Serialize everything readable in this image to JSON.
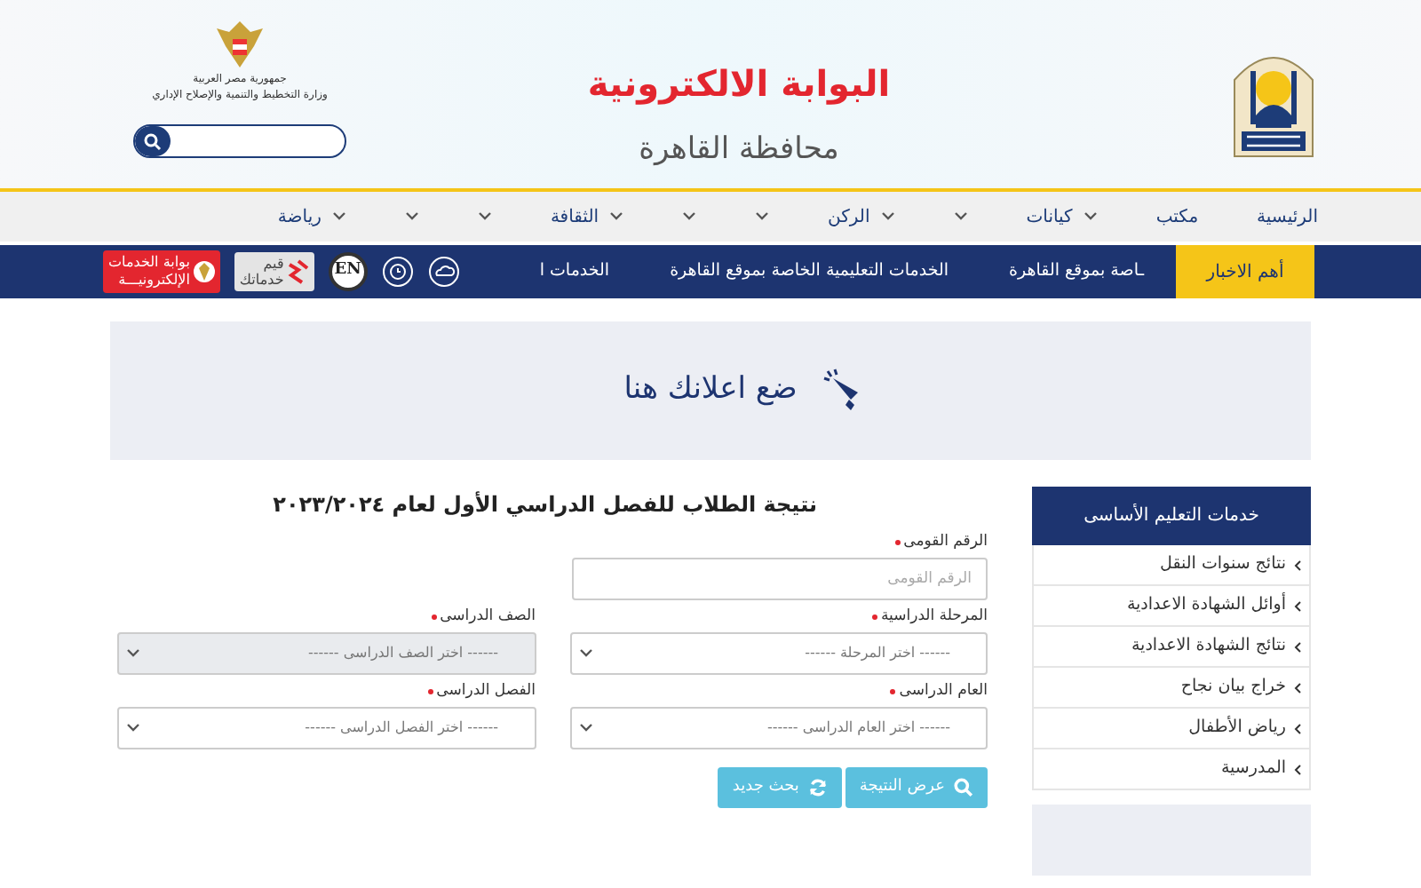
{
  "header": {
    "site_title": "البوابة الالكترونية",
    "governorate": "محافظة القاهرة",
    "ministry_lines": [
      "جمهورية مصر العربية",
      "وزارة التخطيط والتنمية والإصلاح الإداري"
    ]
  },
  "nav": [
    {
      "label": "الرئيسية",
      "has_menu": false
    },
    {
      "label": "مكتب",
      "has_menu": false
    },
    {
      "label": "كيانات",
      "has_menu": true
    },
    {
      "has_menu": true
    },
    {
      "label": "الركن",
      "has_menu": true
    },
    {
      "has_menu": true
    },
    {
      "has_menu": true
    },
    {
      "label": "الثقافة",
      "has_menu": true
    },
    {
      "has_menu": true
    },
    {
      "has_menu": true
    },
    {
      "label": "رياضة",
      "has_menu": true
    }
  ],
  "news_bar": {
    "label": "أهم الاخبار",
    "ticker": [
      "ـاصة بموقع القاهرة",
      "الخدمات التعليمية الخاصة بموقع القاهرة",
      "الخدمات ا"
    ],
    "language": "EN",
    "rate_badge": [
      "قيم",
      "خدماتك"
    ],
    "eservices_badge": [
      "بوابة الخدمات",
      "الإلكترونيـــة"
    ]
  },
  "ad_banner": {
    "text": "ضع اعلانك هنا"
  },
  "form": {
    "title": "نتيجة الطلاب للفصل الدراسي الأول لعام ٢٠٢٣/٢٠٢٤",
    "fields": [
      {
        "kind": "text",
        "label": "الرقم القومى",
        "required": true,
        "placeholder": "الرقم القومى",
        "disabled": false
      },
      {
        "kind": "select",
        "label": "المرحلة الدراسية",
        "required": true,
        "value": "------ اختر المرحلة ------",
        "disabled": false
      },
      {
        "kind": "select",
        "label": "الصف الدراسى",
        "required": true,
        "value": "------ اختر الصف الدراسى ------",
        "disabled": true
      },
      {
        "kind": "select",
        "label": "العام الدراسى",
        "required": true,
        "value": "------ اختر العام الدراسى ------",
        "disabled": false
      },
      {
        "kind": "select",
        "label": "الفصل الدراسى",
        "required": true,
        "value": "------ اختر الفصل الدراسى ------",
        "disabled": false
      }
    ],
    "buttons": [
      {
        "kind": "search",
        "label": "عرض النتيجة"
      },
      {
        "kind": "refresh",
        "label": "بحث جديد"
      }
    ]
  },
  "sidebar": {
    "title": "خدمات التعليم الأساسى",
    "items": [
      "نتائج سنوات النقل",
      "أوائل الشهادة الاعدادية",
      "نتائج الشهادة الاعدادية",
      "خراج بيان نجاح",
      "رياض الأطفال",
      "المدرسية"
    ]
  }
}
